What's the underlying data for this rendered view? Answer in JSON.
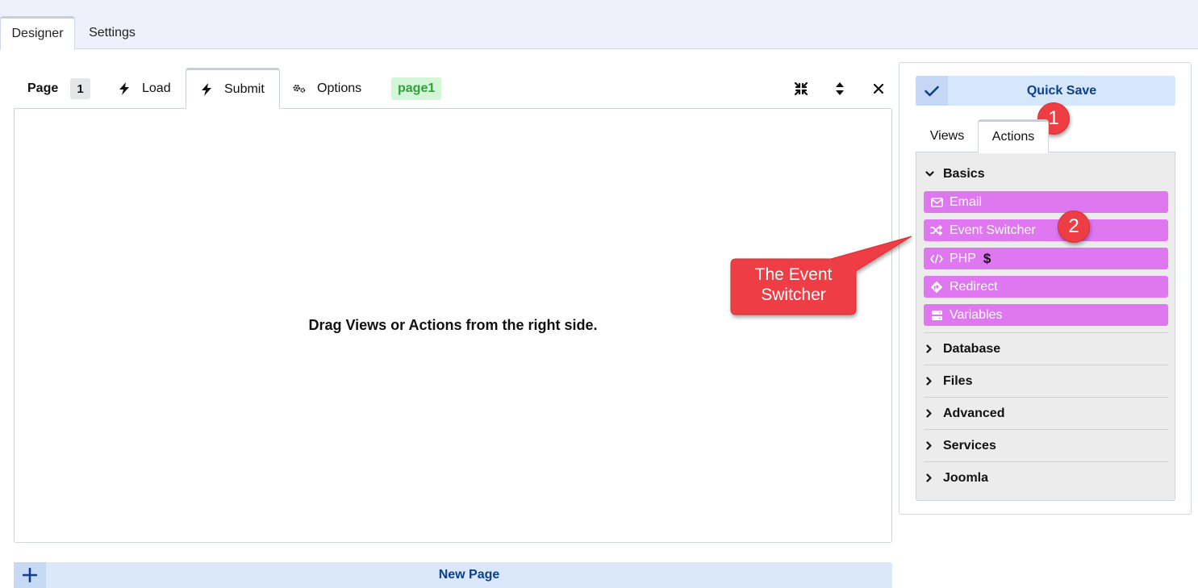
{
  "top_tabs": [
    {
      "label": "Designer",
      "active": true
    },
    {
      "label": "Settings",
      "active": false
    }
  ],
  "designer": {
    "page_label": "Page",
    "page_number": "1",
    "tabs": [
      {
        "label": "Load",
        "icon": "bolt-icon",
        "active": false
      },
      {
        "label": "Submit",
        "icon": "bolt-icon",
        "active": true
      },
      {
        "label": "Options",
        "icon": "cogs-icon",
        "active": false
      }
    ],
    "page_badge": "page1",
    "tool_icons": [
      "compress-icon",
      "sort-icon",
      "close-icon"
    ],
    "canvas_message": "Drag Views or Actions from the right side.",
    "new_page_label": "New Page"
  },
  "right_panel": {
    "quick_save_label": "Quick Save",
    "tabs": [
      {
        "label": "Views",
        "active": false
      },
      {
        "label": "Actions",
        "active": true
      }
    ],
    "expanded_category": "Basics",
    "items": [
      {
        "label": "Email",
        "icon": "envelope-icon"
      },
      {
        "label": "Event Switcher",
        "icon": "shuffle-icon"
      },
      {
        "label": "PHP",
        "icon": "code-icon",
        "suffix": "$"
      },
      {
        "label": "Redirect",
        "icon": "directions-icon"
      },
      {
        "label": "Variables",
        "icon": "server-icon"
      }
    ],
    "collapsed_categories": [
      "Database",
      "Files",
      "Advanced",
      "Services",
      "Joomla"
    ]
  },
  "annotations": {
    "badge_1": "1",
    "badge_2": "2",
    "callout_text": "The Event Switcher"
  },
  "colors": {
    "accent_purple": "#df77f1",
    "quick_save_bg": "#d6e6fb",
    "badge_red": "#ee3e44",
    "page_badge_green": "#2fa13b"
  }
}
